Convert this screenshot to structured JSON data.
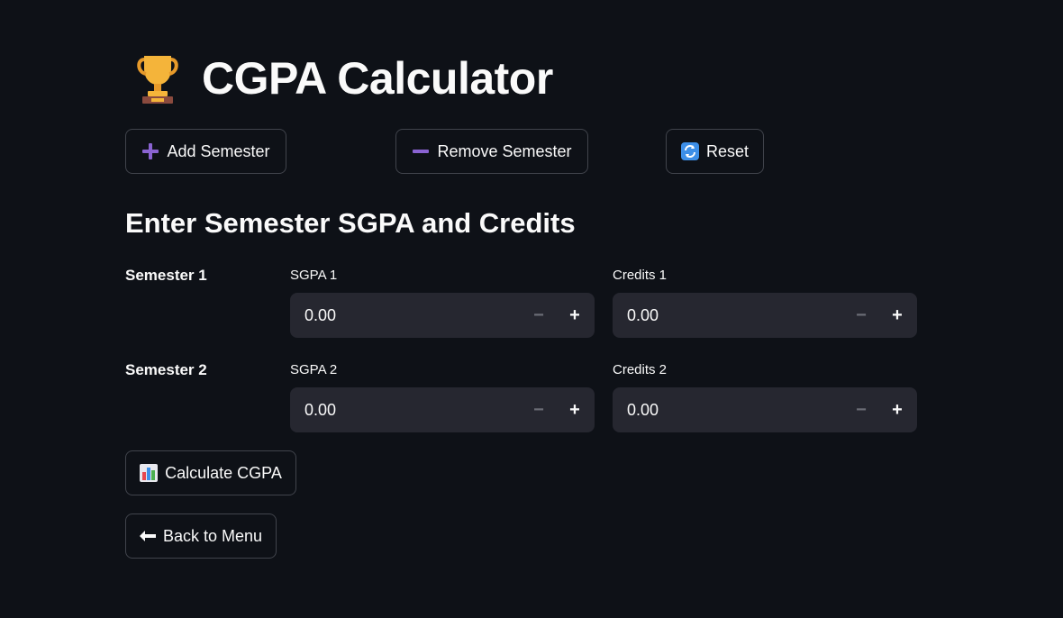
{
  "header": {
    "title": "CGPA Calculator",
    "icon": "trophy-icon"
  },
  "toolbar": {
    "add_label": "Add Semester",
    "remove_label": "Remove Semester",
    "reset_label": "Reset"
  },
  "section": {
    "heading": "Enter Semester SGPA and Credits"
  },
  "semesters": [
    {
      "label": "Semester 1",
      "sgpa_label": "SGPA 1",
      "sgpa_value": "0.00",
      "credits_label": "Credits 1",
      "credits_value": "0.00"
    },
    {
      "label": "Semester 2",
      "sgpa_label": "SGPA 2",
      "sgpa_value": "0.00",
      "credits_label": "Credits 2",
      "credits_value": "0.00"
    }
  ],
  "actions": {
    "calculate_label": "Calculate CGPA",
    "back_label": "Back to Menu"
  },
  "colors": {
    "background": "#0e1117",
    "input_bg": "#262730",
    "border": "#41444c",
    "accent_purple": "#8a63d2"
  }
}
